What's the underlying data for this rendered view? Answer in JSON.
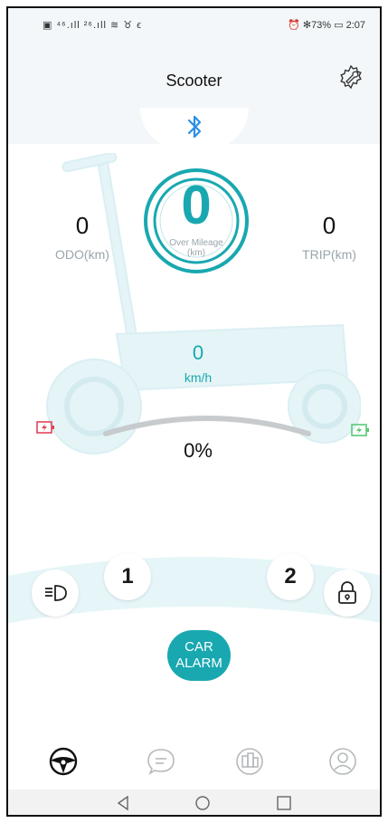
{
  "status_bar": {
    "left_icons": "▣ ⁴⁶.ıll ²⁶.ıll ≋ ♉ ϵ",
    "right_text": "⏰ ✻73% ▭ 2:07"
  },
  "header": {
    "title": "Scooter"
  },
  "stats": {
    "odo_value": "0",
    "odo_label": "ODO(km)",
    "trip_value": "0",
    "trip_label": "TRIP(km)",
    "over_mileage_value": "0",
    "over_mileage_label": "Over Mileage",
    "over_mileage_unit": "(km)"
  },
  "speed": {
    "value": "0",
    "unit": "km/h"
  },
  "battery": {
    "percent_text": "0%",
    "level": 0
  },
  "controls": {
    "mode1": "1",
    "mode2": "2",
    "alarm_line1": "CAR",
    "alarm_line2": "ALARM"
  },
  "colors": {
    "accent": "#19a8b0",
    "band": "#e6f6f8",
    "battery_low": "#e0455a",
    "battery_high": "#5ac777"
  },
  "icons": [
    "gear-icon",
    "bluetooth-icon",
    "headlight-icon",
    "lock-icon",
    "steering-wheel-icon",
    "chat-icon",
    "devices-icon",
    "profile-icon",
    "back-icon",
    "home-icon",
    "recents-icon"
  ]
}
